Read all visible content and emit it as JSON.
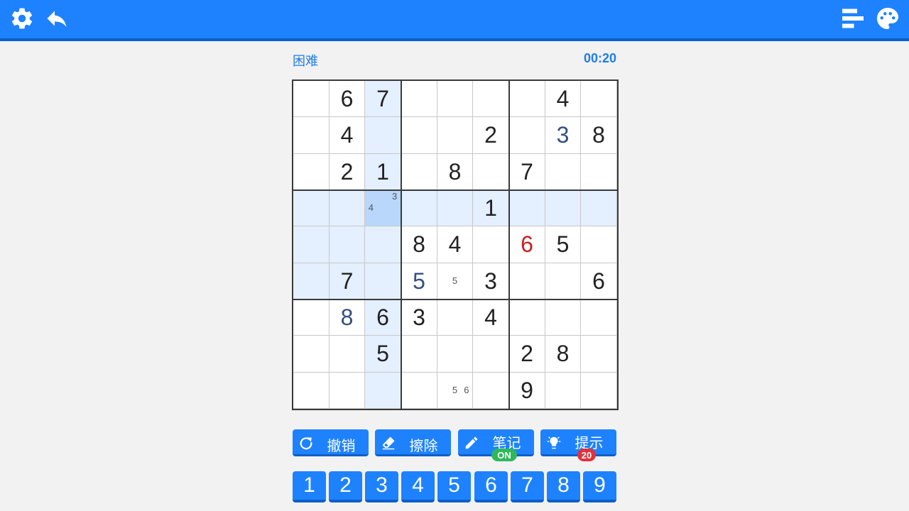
{
  "toolbar": {
    "left_icons": [
      "gear-icon",
      "undo-arrow-icon"
    ],
    "right_icons": [
      "bar-chart-icon",
      "palette-icon"
    ],
    "bg_color": "#1e82ff"
  },
  "game": {
    "difficulty": "困难",
    "timer": "00:20"
  },
  "board": {
    "selected": [
      3,
      2
    ],
    "rows": [
      [
        {
          "v": ""
        },
        {
          "v": "6"
        },
        {
          "v": "7"
        },
        {
          "v": ""
        },
        {
          "v": ""
        },
        {
          "v": ""
        },
        {
          "v": ""
        },
        {
          "v": "4"
        },
        {
          "v": ""
        }
      ],
      [
        {
          "v": ""
        },
        {
          "v": "4"
        },
        {
          "v": ""
        },
        {
          "v": ""
        },
        {
          "v": ""
        },
        {
          "v": "2"
        },
        {
          "v": ""
        },
        {
          "v": "3",
          "t": "user"
        },
        {
          "v": "8"
        }
      ],
      [
        {
          "v": ""
        },
        {
          "v": "2"
        },
        {
          "v": "1"
        },
        {
          "v": ""
        },
        {
          "v": "8"
        },
        {
          "v": ""
        },
        {
          "v": "7"
        },
        {
          "v": ""
        },
        {
          "v": ""
        }
      ],
      [
        {
          "v": ""
        },
        {
          "v": ""
        },
        {
          "v": "",
          "notes": [
            "3",
            "4"
          ]
        },
        {
          "v": ""
        },
        {
          "v": ""
        },
        {
          "v": "1"
        },
        {
          "v": ""
        },
        {
          "v": ""
        },
        {
          "v": ""
        }
      ],
      [
        {
          "v": ""
        },
        {
          "v": ""
        },
        {
          "v": ""
        },
        {
          "v": "8"
        },
        {
          "v": "4"
        },
        {
          "v": ""
        },
        {
          "v": "6",
          "t": "err"
        },
        {
          "v": "5"
        },
        {
          "v": ""
        }
      ],
      [
        {
          "v": ""
        },
        {
          "v": "7"
        },
        {
          "v": ""
        },
        {
          "v": "5",
          "t": "user"
        },
        {
          "v": "",
          "notes": [
            "5"
          ]
        },
        {
          "v": "3"
        },
        {
          "v": ""
        },
        {
          "v": ""
        },
        {
          "v": "6"
        }
      ],
      [
        {
          "v": ""
        },
        {
          "v": "8",
          "t": "user"
        },
        {
          "v": "6"
        },
        {
          "v": "3"
        },
        {
          "v": ""
        },
        {
          "v": "4"
        },
        {
          "v": ""
        },
        {
          "v": ""
        },
        {
          "v": ""
        }
      ],
      [
        {
          "v": ""
        },
        {
          "v": ""
        },
        {
          "v": "5"
        },
        {
          "v": ""
        },
        {
          "v": ""
        },
        {
          "v": ""
        },
        {
          "v": "2"
        },
        {
          "v": "8"
        },
        {
          "v": ""
        }
      ],
      [
        {
          "v": ""
        },
        {
          "v": ""
        },
        {
          "v": ""
        },
        {
          "v": ""
        },
        {
          "v": "",
          "notes": [
            "5",
            "6"
          ]
        },
        {
          "v": ""
        },
        {
          "v": "9"
        },
        {
          "v": ""
        },
        {
          "v": ""
        }
      ]
    ]
  },
  "actions": [
    {
      "id": "undo",
      "label": "撤销",
      "icon": "rotate-icon"
    },
    {
      "id": "erase",
      "label": "擦除",
      "icon": "eraser-icon"
    },
    {
      "id": "notes",
      "label": "笔记",
      "icon": "pencil-icon",
      "badge": "ON"
    },
    {
      "id": "hint",
      "label": "提示",
      "icon": "lightbulb-icon",
      "badge": "20"
    }
  ],
  "numpad": [
    "1",
    "2",
    "3",
    "4",
    "5",
    "6",
    "7",
    "8",
    "9"
  ]
}
